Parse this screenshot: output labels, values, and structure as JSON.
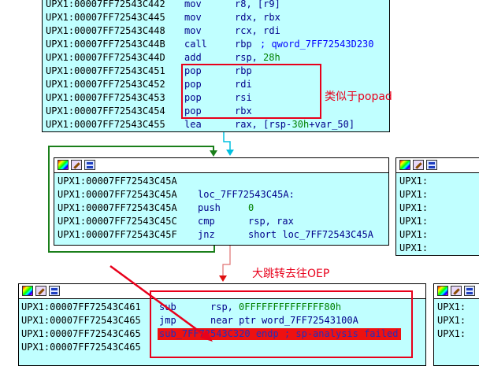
{
  "node1": {
    "lines": [
      {
        "addr": "UPX1:00007FF72543C442",
        "mn": "mov",
        "op": "r8, [r9]"
      },
      {
        "addr": "UPX1:00007FF72543C445",
        "mn": "mov",
        "op": "rdx, rbx"
      },
      {
        "addr": "UPX1:00007FF72543C448",
        "mn": "mov",
        "op": "rcx, rdi"
      },
      {
        "addr": "UPX1:00007FF72543C44B",
        "mn": "call",
        "op": "rbp",
        "cmt": "; qword_7FF72543D230"
      },
      {
        "addr": "UPX1:00007FF72543C44D",
        "mn": "add",
        "op": "rsp,",
        "num": "28h"
      },
      {
        "addr": "UPX1:00007FF72543C451",
        "mn": "pop",
        "op": "rbp"
      },
      {
        "addr": "UPX1:00007FF72543C452",
        "mn": "pop",
        "op": "rdi"
      },
      {
        "addr": "UPX1:00007FF72543C453",
        "mn": "pop",
        "op": "rsi"
      },
      {
        "addr": "UPX1:00007FF72543C454",
        "mn": "pop",
        "op": "rbx"
      },
      {
        "addr": "UPX1:00007FF72543C455",
        "mn": "lea",
        "op": "rax, [rsp-",
        "num": "30h",
        "op2": "+var_50]"
      }
    ]
  },
  "node2": {
    "lines": [
      {
        "addr": "UPX1:00007FF72543C45A"
      },
      {
        "addr": "UPX1:00007FF72543C45A",
        "lbl": "loc_7FF72543C45A:"
      },
      {
        "addr": "UPX1:00007FF72543C45A",
        "mn": "push",
        "num": "0"
      },
      {
        "addr": "UPX1:00007FF72543C45C",
        "mn": "cmp",
        "op": "rsp, rax"
      },
      {
        "addr": "UPX1:00007FF72543C45F",
        "mn": "jnz",
        "op": "short loc_7FF72543C45A"
      }
    ]
  },
  "node3": {
    "lines": [
      {
        "addr": "UPX1:00007FF72543C461",
        "mn": "sub",
        "op": "rsp,",
        "num": "0FFFFFFFFFFFFFF80h"
      },
      {
        "addr": "UPX1:00007FF72543C465",
        "mn": "jmp",
        "op": "near ptr word_7FF72543100A"
      },
      {
        "addr": "UPX1:00007FF72543C465",
        "hl": "sub_7FF72543C320 endp ; sp-analysis failed"
      },
      {
        "addr": "UPX1:00007FF72543C465"
      }
    ]
  },
  "right_top": {
    "prefix": [
      "UPX1:",
      "UPX1:",
      "UPX1:",
      "UPX1:",
      "UPX1:",
      "UPX1:"
    ]
  },
  "right_bottom": {
    "prefix": [
      "UPX1:",
      "UPX1:",
      "UPX1:"
    ]
  },
  "annotations": {
    "popad": "类似于popad",
    "oep": "大跳转去往OEP"
  },
  "colors": {
    "node_bg": "#c0ffff",
    "annotation": "#e8001b",
    "highlight": "#ee1111"
  }
}
